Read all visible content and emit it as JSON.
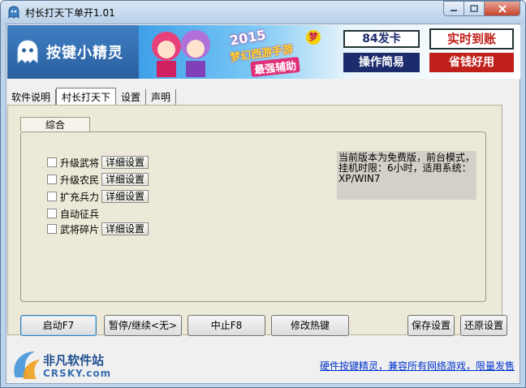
{
  "window": {
    "title": "村长打天下单开1.01",
    "icon": "app-icon",
    "caption_buttons": [
      "minimize-icon",
      "maximize-icon",
      "close-icon"
    ]
  },
  "banner": {
    "logo_text": "按键小精灵",
    "logo_icon": "ghost-logo-icon",
    "ad": {
      "year": "2015",
      "game": "梦幻西游手游",
      "assist": "最强辅助",
      "badge": "梦",
      "card": "84发卡",
      "simple": "操作简易",
      "fast": "实时到账",
      "save": "省钱好用"
    }
  },
  "tabs": [
    {
      "label": "软件说明",
      "active": false
    },
    {
      "label": "村长打天下",
      "active": true
    },
    {
      "label": "设置",
      "active": false
    },
    {
      "label": "声明",
      "active": false
    }
  ],
  "subtab": {
    "label": "综合"
  },
  "options": [
    {
      "label": "升级武将",
      "checked": false,
      "detail_label": "详细设置"
    },
    {
      "label": "升级农民",
      "checked": false,
      "detail_label": "详细设置"
    },
    {
      "label": "扩充兵力",
      "checked": false,
      "detail_label": "详细设置"
    },
    {
      "label": "自动征兵",
      "checked": false,
      "detail_label": ""
    },
    {
      "label": "武将碎片",
      "checked": false,
      "detail_label": "详细设置"
    }
  ],
  "info_text": "当前版本为免费版，前台模式，\n挂机时限：6小时，适用系统：\nXP/WIN7",
  "buttons": {
    "start": "启动F7",
    "pause": "暂停/继续<无>",
    "stop": "中止F8",
    "hotkey": "修改热键",
    "save": "保存设置",
    "restore": "还原设置"
  },
  "footer": {
    "watermark": "非凡软件站",
    "watermark_sub": "CRSKY.com",
    "link": "硬件按键精灵，兼容所有网络游戏，限量发售"
  },
  "colors": {
    "window_frame": "#bcd3ea",
    "client_bg": "#f0f0f0",
    "group_bg": "#ece9d8",
    "info_bg": "#d4d0c8",
    "link": "#0033cc",
    "close_button": "#c8442d"
  }
}
